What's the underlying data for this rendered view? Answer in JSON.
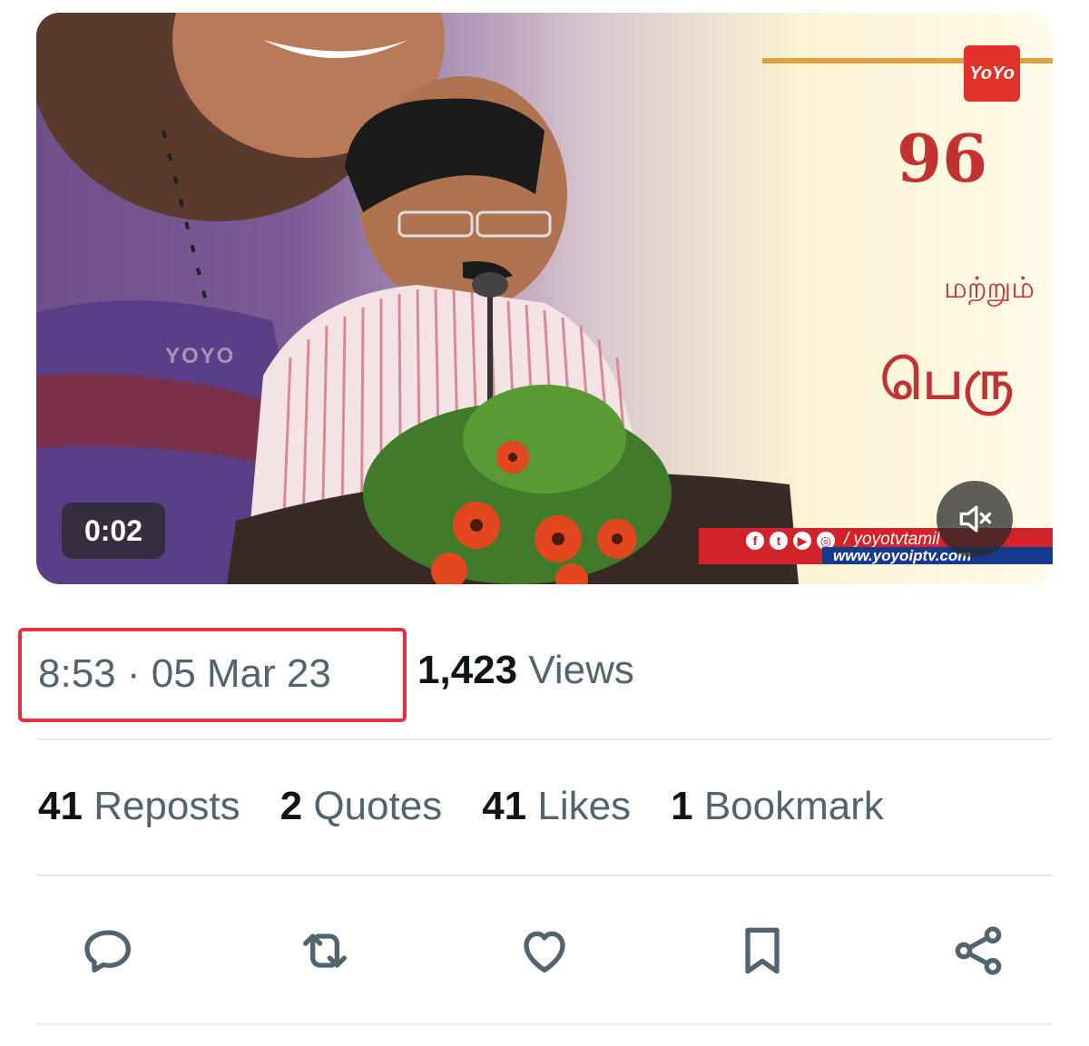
{
  "video": {
    "duration": "0:02",
    "channel_logo": "YoYo",
    "watermark": "YOYO",
    "poster_number": "96",
    "poster_line_2": "மற்றும்",
    "poster_line_3": "பெரு",
    "ticker_handle": "/ yoyotvtamil",
    "ticker_site": "www.yoyoiptv.com",
    "mute_icon": "speaker-muted-icon"
  },
  "tweet_meta": {
    "timestamp": "8:53 · 05 Mar 23",
    "views_count": "1,423",
    "views_label": "Views",
    "highlight_color": "#e3313e"
  },
  "stats": {
    "reposts_count": "41",
    "reposts_label": "Reposts",
    "quotes_count": "2",
    "quotes_label": "Quotes",
    "likes_count": "41",
    "likes_label": "Likes",
    "bookmarks_count": "1",
    "bookmarks_label": "Bookmark"
  },
  "actions": [
    "reply-icon",
    "repost-icon",
    "like-icon",
    "bookmark-icon",
    "share-icon"
  ],
  "colors": {
    "text_primary": "#0f1419",
    "text_secondary": "#536471",
    "divider": "#e6e9ec"
  }
}
